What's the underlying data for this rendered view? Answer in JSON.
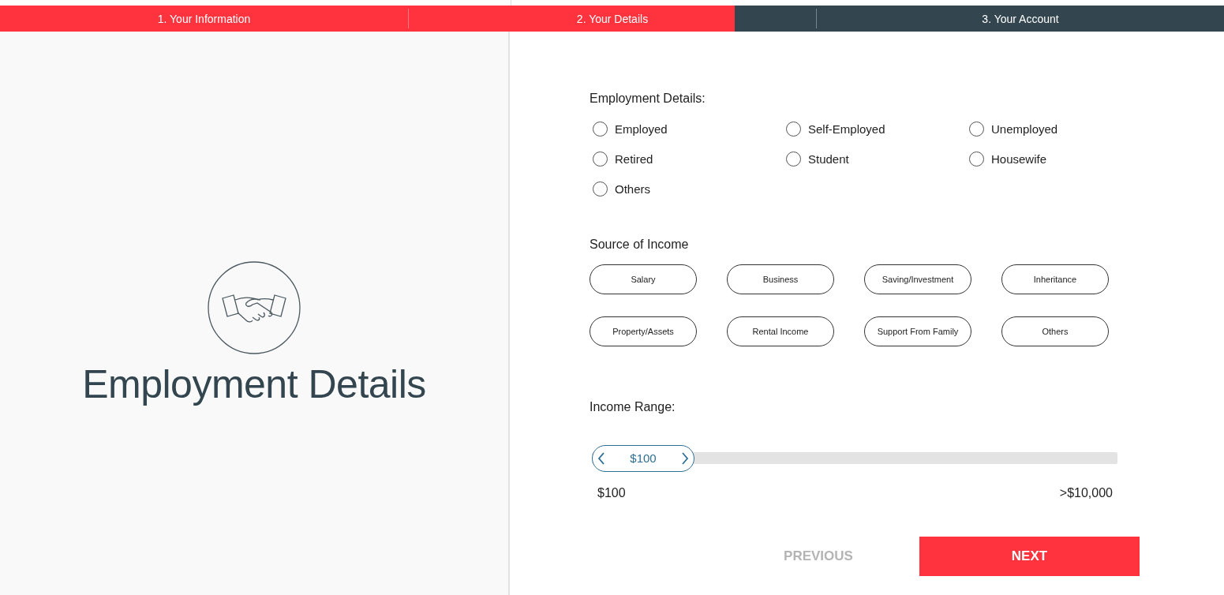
{
  "progress": {
    "level": 0.6,
    "steps": [
      {
        "label": "1. Your Information"
      },
      {
        "label": "2. Your Details"
      },
      {
        "label": "3. Your Account"
      }
    ]
  },
  "intro": {
    "title": "Employment Details"
  },
  "employment": {
    "label": "Employment Details:",
    "options": [
      {
        "label": "Employed",
        "selected": false
      },
      {
        "label": "Self-Employed",
        "selected": false
      },
      {
        "label": "Unemployed",
        "selected": false
      },
      {
        "label": "Retired",
        "selected": false
      },
      {
        "label": "Student",
        "selected": false
      },
      {
        "label": "Housewife",
        "selected": false
      },
      {
        "label": "Others",
        "selected": false
      }
    ]
  },
  "income_source": {
    "label": "Source of Income",
    "options": [
      {
        "label": "Salary",
        "selected": false
      },
      {
        "label": "Business",
        "selected": false
      },
      {
        "label": "Saving/Investment",
        "selected": false
      },
      {
        "label": "Inheritance",
        "selected": false
      },
      {
        "label": "Property/Assets",
        "selected": false
      },
      {
        "label": "Rental Income",
        "selected": false
      },
      {
        "label": "Support From Family",
        "selected": false
      },
      {
        "label": "Others",
        "selected": false
      }
    ]
  },
  "income_range": {
    "label": "Income Range:",
    "value": "$100",
    "level": 0,
    "min_label": "$100",
    "max_label": ">$10,000"
  },
  "buttons": {
    "previous": {
      "label": "PREVIOUS",
      "disabled": true
    },
    "next": {
      "label": "NEXT",
      "disabled": false
    }
  }
}
